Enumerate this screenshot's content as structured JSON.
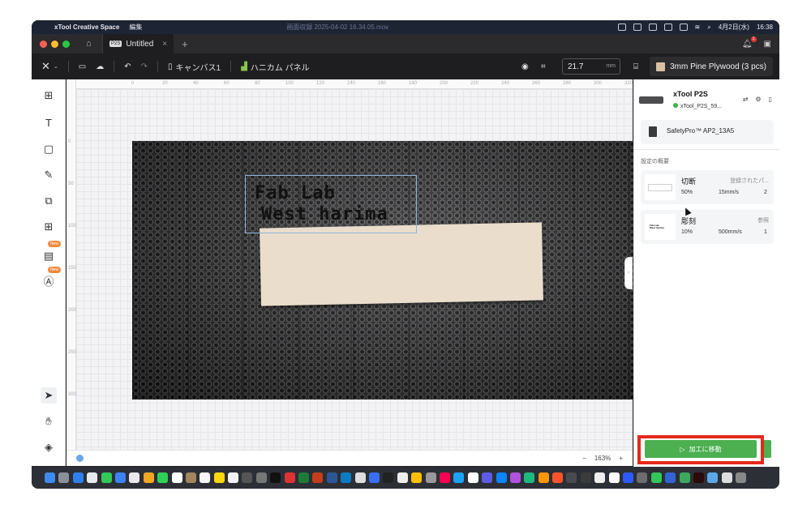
{
  "menubar": {
    "app_name": "xTool Creative Space",
    "menu_edit": "編集",
    "recording": "画面収録 2025-04-02 16.34.05.mov",
    "date": "4月2日(水)",
    "time": "16:38"
  },
  "tabbar": {
    "tab_badge": "P2S",
    "tab_title": "Untitled",
    "notification_count": "1"
  },
  "toolbar": {
    "canvas_label": "キャンバス1",
    "panel_label": "ハニカム パネル",
    "height_value": "21.7",
    "height_unit": "mm",
    "material": "3mm Pine Plywood (3 pcs)"
  },
  "canvas": {
    "text_line1": "Fab Lab",
    "text_line2": "West harima",
    "zoom": "163%",
    "ruler_h": [
      "0",
      "20",
      "40",
      "60",
      "80",
      "100",
      "120",
      "140",
      "160",
      "180",
      "200",
      "220",
      "240",
      "260",
      "280",
      "300",
      "320"
    ],
    "ruler_v": [
      "0",
      "50",
      "100",
      "150",
      "200",
      "250",
      "300"
    ]
  },
  "panel": {
    "machine_name": "xTool P2S",
    "machine_wifi": "xTool_P2S_59...",
    "safety": "SafetyPro™ AP2_13A5",
    "overview_label": "設定の概要",
    "cards": [
      {
        "title": "切断",
        "tag": "登録されたパ...",
        "power": "50%",
        "speed": "15mm/s",
        "passes": "2"
      },
      {
        "title": "彫刻",
        "tag": "参照",
        "power": "10%",
        "speed": "500mm/s",
        "passes": "1"
      }
    ],
    "go_button": "加工に移動"
  },
  "colors": {
    "accent_green": "#4caf50",
    "highlight_red": "#e4291b",
    "wood": "#eaddcc"
  }
}
